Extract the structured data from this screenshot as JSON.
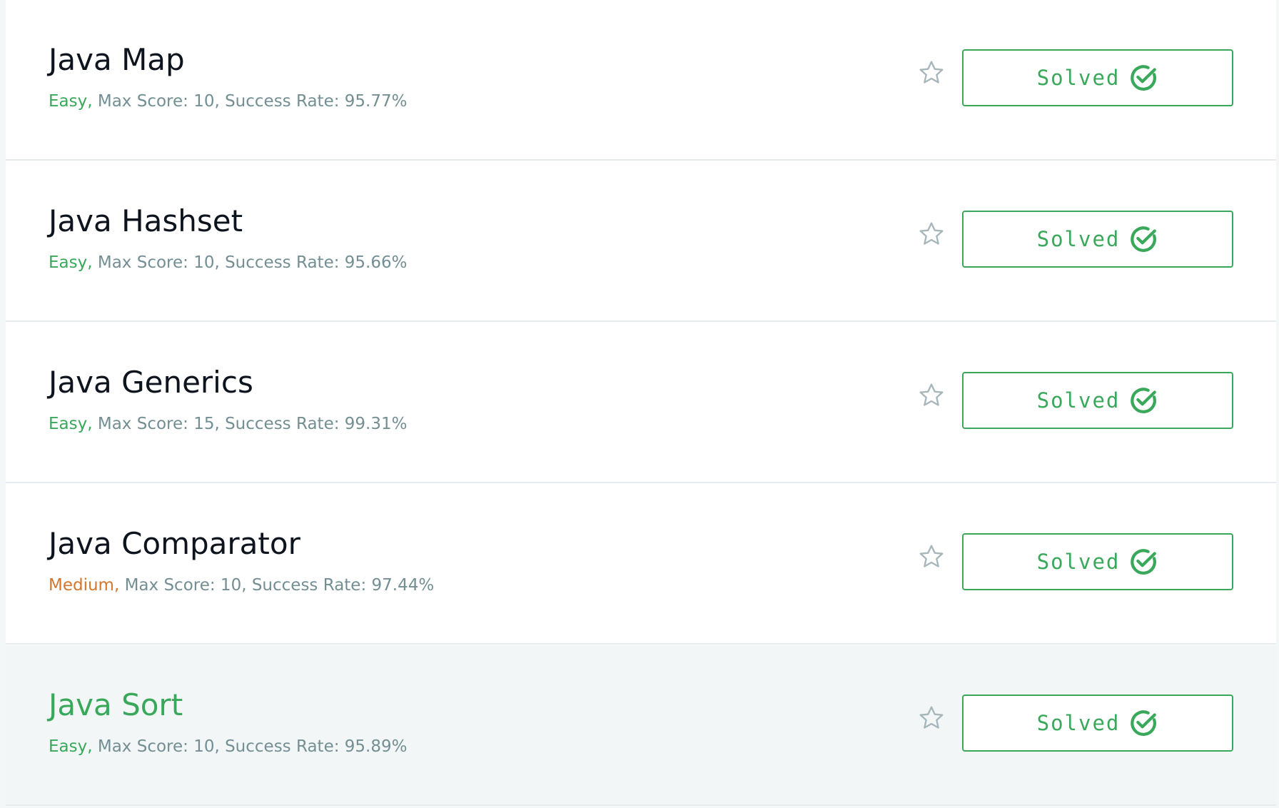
{
  "challenges": [
    {
      "title": "Java Map",
      "difficulty": "Easy,",
      "difficulty_level": "easy",
      "details": " Max Score: 10, Success Rate: 95.77%",
      "status": "Solved",
      "highlighted": false
    },
    {
      "title": "Java Hashset",
      "difficulty": "Easy,",
      "difficulty_level": "easy",
      "details": " Max Score: 10, Success Rate: 95.66%",
      "status": "Solved",
      "highlighted": false
    },
    {
      "title": "Java Generics",
      "difficulty": "Easy,",
      "difficulty_level": "easy",
      "details": " Max Score: 15, Success Rate: 99.31%",
      "status": "Solved",
      "highlighted": false
    },
    {
      "title": "Java Comparator",
      "difficulty": "Medium,",
      "difficulty_level": "medium",
      "details": " Max Score: 10, Success Rate: 97.44%",
      "status": "Solved",
      "highlighted": false
    },
    {
      "title": "Java Sort",
      "difficulty": "Easy,",
      "difficulty_level": "easy",
      "details": " Max Score: 10, Success Rate: 95.89%",
      "status": "Solved",
      "highlighted": true
    }
  ],
  "icons": {
    "bookmark": "star-outline-icon",
    "solved": "check-circle-icon"
  },
  "colors": {
    "easy": "#39a85a",
    "medium": "#d1772e",
    "solved_accent": "#39a85a",
    "title": "#0e141e",
    "meta": "#738f93",
    "highlight_row": "#f2f6f7"
  }
}
